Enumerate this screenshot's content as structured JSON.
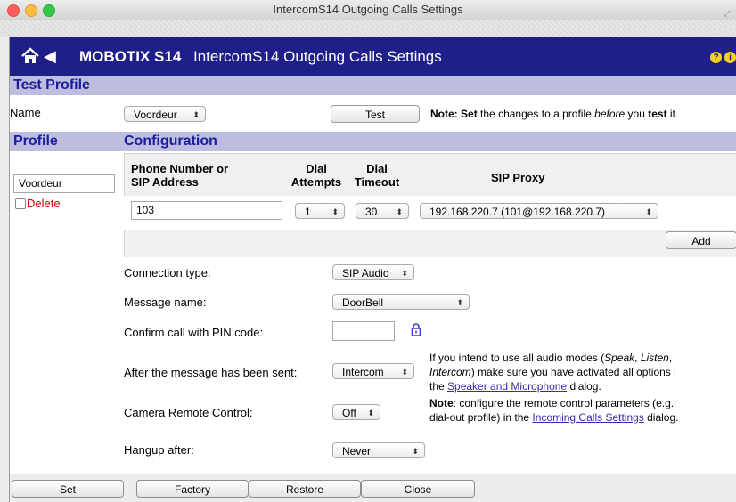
{
  "window": {
    "title": "IntercomS14 Outgoing Calls Settings"
  },
  "header": {
    "brand": "MOBOTIX S14",
    "title": "IntercomS14 Outgoing Calls Settings",
    "help": "?",
    "info": "i"
  },
  "test_profile": {
    "section_title": "Test Profile",
    "name_label": "Name",
    "name_value": "Voordeur",
    "test_button": "Test",
    "note_prefix": "Note:",
    "note_set": "Set",
    "note_mid": "the changes to a profile",
    "note_before": "before",
    "note_you": "you",
    "note_test": "test",
    "note_end": "it."
  },
  "profile": {
    "section_title": "Profile",
    "name_value": "Voordeur",
    "delete_label": "Delete"
  },
  "configuration": {
    "section_title": "Configuration",
    "col_phone_1": "Phone Number or",
    "col_phone_2": "SIP Address",
    "col_attempts_1": "Dial",
    "col_attempts_2": "Attempts",
    "col_timeout_1": "Dial",
    "col_timeout_2": "Timeout",
    "col_proxy": "SIP Proxy",
    "phone_value": "103",
    "attempts_value": "1",
    "timeout_value": "30",
    "proxy_value": "192.168.220.7 (101@192.168.220.7)",
    "add_button": "Add"
  },
  "settings": {
    "connection_type_label": "Connection type:",
    "connection_type_value": "SIP Audio",
    "message_name_label": "Message name:",
    "message_name_value": "DoorBell",
    "confirm_pin_label": "Confirm call with PIN code:",
    "confirm_pin_value": "",
    "after_message_label": "After the message has been sent:",
    "after_message_value": "Intercom",
    "after_note_1a": "If you intend to use all audio modes (",
    "after_note_speak": "Speak",
    "after_note_comma1": ", ",
    "after_note_listen": "Listen",
    "after_note_comma2": ",",
    "after_note_intercom": "Intercom",
    "after_note_2b": ") make sure you have activated all options i",
    "after_note_3a": "the ",
    "after_note_link": "Speaker and Microphone",
    "after_note_3b": " dialog.",
    "camera_remote_label": "Camera Remote Control:",
    "camera_remote_value": "Off",
    "camera_note_prefix": "Note",
    "camera_note_1": ": configure the remote control parameters (e.g.",
    "camera_note_2a": "dial-out profile) in the ",
    "camera_note_link": "Incoming Calls Settings",
    "camera_note_2b": " dialog.",
    "hangup_label": "Hangup after:",
    "hangup_value": "Never"
  },
  "footer": {
    "set": "Set",
    "factory": "Factory",
    "restore": "Restore",
    "close": "Close"
  }
}
